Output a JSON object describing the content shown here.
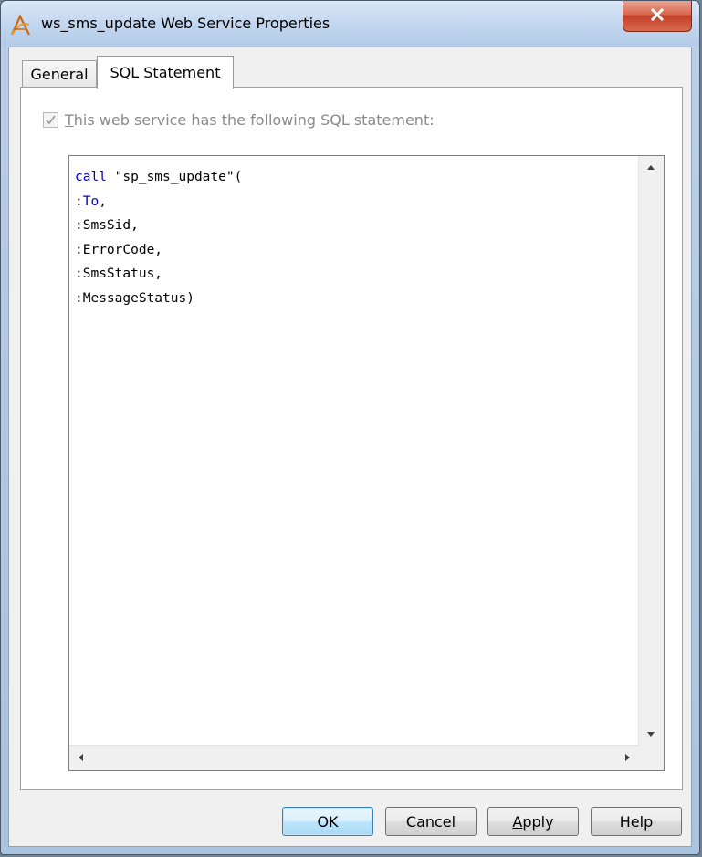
{
  "window": {
    "title": "ws_sms_update Web Service Properties"
  },
  "tabs": [
    {
      "label": "General"
    },
    {
      "label": "SQL Statement"
    }
  ],
  "sql_tab": {
    "checkbox_label_first": "T",
    "checkbox_label_rest": "his web service has the following SQL statement:",
    "checkbox_checked": true
  },
  "sql_code": {
    "line1_keyword": "call",
    "line1_rest": " \"sp_sms_update\"(",
    "line2_prefix": ":",
    "line2_name": "To",
    "line2_suffix": ",",
    "line3": ":SmsSid,",
    "line4": ":ErrorCode,",
    "line5": ":SmsStatus,",
    "line6": ":MessageStatus)"
  },
  "buttons": {
    "ok": "OK",
    "cancel": "Cancel",
    "apply_first": "A",
    "apply_rest": "pply",
    "help": "Help"
  },
  "icons": {
    "app": "web-service-icon",
    "close": "close-icon"
  },
  "colors": {
    "keyword": "#0000cc",
    "close_button": "#c4402a",
    "default_button_border": "#3c7fb1"
  }
}
